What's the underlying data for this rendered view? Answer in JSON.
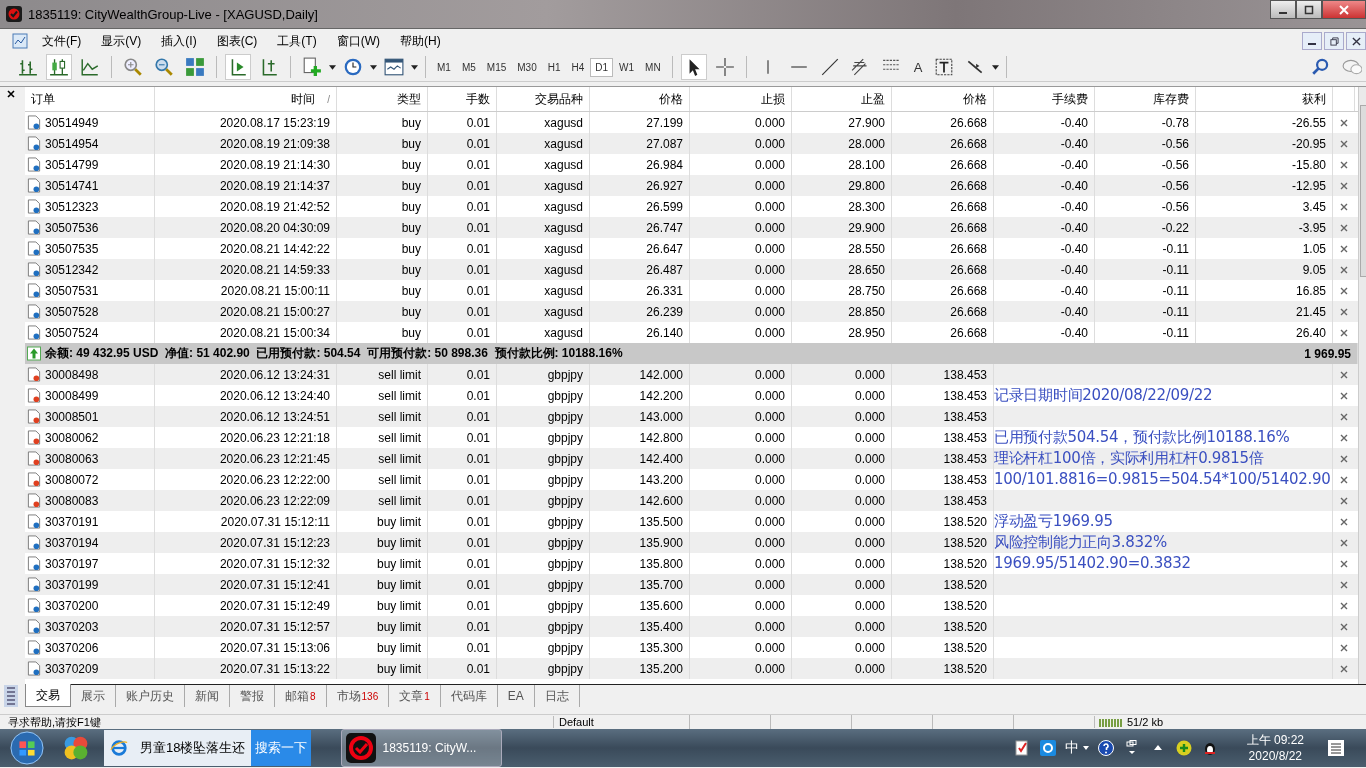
{
  "window": {
    "title": "1835119: CityWealthGroup-Live - [XAGUSD,Daily]"
  },
  "menu": [
    "文件(F)",
    "显示(V)",
    "插入(I)",
    "图表(C)",
    "工具(T)",
    "窗口(W)",
    "帮助(H)"
  ],
  "timeframes": [
    {
      "label": "M1",
      "selected": false
    },
    {
      "label": "M5",
      "selected": false
    },
    {
      "label": "M15",
      "selected": false
    },
    {
      "label": "M30",
      "selected": false
    },
    {
      "label": "H1",
      "selected": false
    },
    {
      "label": "H4",
      "selected": false
    },
    {
      "label": "D1",
      "selected": true
    },
    {
      "label": "W1",
      "selected": false
    },
    {
      "label": "MN",
      "selected": false
    }
  ],
  "text_tool": "A",
  "table": {
    "columns": [
      "订单",
      "时间",
      "类型",
      "手数",
      "交易品种",
      "价格",
      "止损",
      "止盈",
      "价格",
      "手续费",
      "库存费",
      "获利"
    ],
    "sort_mark": "/",
    "positions": [
      {
        "kind": "buy",
        "cells": [
          "30514949",
          "2020.08.17 15:23:19",
          "buy",
          "0.01",
          "xagusd",
          "27.199",
          "0.000",
          "27.900",
          "26.668",
          "-0.40",
          "-0.78",
          "-26.55"
        ]
      },
      {
        "kind": "buy",
        "cells": [
          "30514954",
          "2020.08.19 21:09:38",
          "buy",
          "0.01",
          "xagusd",
          "27.087",
          "0.000",
          "28.000",
          "26.668",
          "-0.40",
          "-0.56",
          "-20.95"
        ]
      },
      {
        "kind": "buy",
        "cells": [
          "30514799",
          "2020.08.19 21:14:30",
          "buy",
          "0.01",
          "xagusd",
          "26.984",
          "0.000",
          "28.100",
          "26.668",
          "-0.40",
          "-0.56",
          "-15.80"
        ]
      },
      {
        "kind": "buy",
        "cells": [
          "30514741",
          "2020.08.19 21:14:37",
          "buy",
          "0.01",
          "xagusd",
          "26.927",
          "0.000",
          "29.800",
          "26.668",
          "-0.40",
          "-0.56",
          "-12.95"
        ]
      },
      {
        "kind": "buy",
        "cells": [
          "30512323",
          "2020.08.19 21:42:52",
          "buy",
          "0.01",
          "xagusd",
          "26.599",
          "0.000",
          "28.300",
          "26.668",
          "-0.40",
          "-0.56",
          "3.45"
        ]
      },
      {
        "kind": "buy",
        "cells": [
          "30507536",
          "2020.08.20 04:30:09",
          "buy",
          "0.01",
          "xagusd",
          "26.747",
          "0.000",
          "29.900",
          "26.668",
          "-0.40",
          "-0.22",
          "-3.95"
        ]
      },
      {
        "kind": "buy",
        "cells": [
          "30507535",
          "2020.08.21 14:42:22",
          "buy",
          "0.01",
          "xagusd",
          "26.647",
          "0.000",
          "28.550",
          "26.668",
          "-0.40",
          "-0.11",
          "1.05"
        ]
      },
      {
        "kind": "buy",
        "cells": [
          "30512342",
          "2020.08.21 14:59:33",
          "buy",
          "0.01",
          "xagusd",
          "26.487",
          "0.000",
          "28.650",
          "26.668",
          "-0.40",
          "-0.11",
          "9.05"
        ]
      },
      {
        "kind": "buy",
        "cells": [
          "30507531",
          "2020.08.21 15:00:11",
          "buy",
          "0.01",
          "xagusd",
          "26.331",
          "0.000",
          "28.750",
          "26.668",
          "-0.40",
          "-0.11",
          "16.85"
        ]
      },
      {
        "kind": "buy",
        "cells": [
          "30507528",
          "2020.08.21 15:00:27",
          "buy",
          "0.01",
          "xagusd",
          "26.239",
          "0.000",
          "28.850",
          "26.668",
          "-0.40",
          "-0.11",
          "21.45"
        ]
      },
      {
        "kind": "buy",
        "cells": [
          "30507524",
          "2020.08.21 15:00:34",
          "buy",
          "0.01",
          "xagusd",
          "26.140",
          "0.000",
          "28.950",
          "26.668",
          "-0.40",
          "-0.11",
          "26.40"
        ]
      }
    ],
    "summary": {
      "text": "余额: 49 432.95 USD  净值: 51 402.90  已用预付款: 504.54  可用预付款: 50 898.36  预付款比例: 10188.16%",
      "profit": "1 969.95"
    },
    "orders": [
      {
        "kind": "sell",
        "cells": [
          "30008498",
          "2020.06.12 13:24:31",
          "sell limit",
          "0.01",
          "gbpjpy",
          "142.000",
          "0.000",
          "0.000",
          "138.453"
        ]
      },
      {
        "kind": "sell",
        "cells": [
          "30008499",
          "2020.06.12 13:24:40",
          "sell limit",
          "0.01",
          "gbpjpy",
          "142.200",
          "0.000",
          "0.000",
          "138.453"
        ],
        "note": "记录日期时间2020/08/22/09/22"
      },
      {
        "kind": "sell",
        "cells": [
          "30008501",
          "2020.06.12 13:24:51",
          "sell limit",
          "0.01",
          "gbpjpy",
          "143.000",
          "0.000",
          "0.000",
          "138.453"
        ]
      },
      {
        "kind": "sell",
        "cells": [
          "30080062",
          "2020.06.23 12:21:18",
          "sell limit",
          "0.01",
          "gbpjpy",
          "142.800",
          "0.000",
          "0.000",
          "138.453"
        ],
        "note": "已用预付款504.54，预付款比例10188.16%"
      },
      {
        "kind": "sell",
        "cells": [
          "30080063",
          "2020.06.23 12:21:45",
          "sell limit",
          "0.01",
          "gbpjpy",
          "142.400",
          "0.000",
          "0.000",
          "138.453"
        ],
        "note": "理论杆杠100倍，实际利用杠杆0.9815倍"
      },
      {
        "kind": "sell",
        "cells": [
          "30080072",
          "2020.06.23 12:22:00",
          "sell limit",
          "0.01",
          "gbpjpy",
          "143.200",
          "0.000",
          "0.000",
          "138.453"
        ],
        "note": "100/101.8816=0.9815=504.54*100/51402.90"
      },
      {
        "kind": "sell",
        "cells": [
          "30080083",
          "2020.06.23 12:22:09",
          "sell limit",
          "0.01",
          "gbpjpy",
          "142.600",
          "0.000",
          "0.000",
          "138.453"
        ]
      },
      {
        "kind": "buy",
        "cells": [
          "30370191",
          "2020.07.31 15:12:11",
          "buy limit",
          "0.01",
          "gbpjpy",
          "135.500",
          "0.000",
          "0.000",
          "138.520"
        ],
        "note": "浮动盈亏1969.95"
      },
      {
        "kind": "buy",
        "cells": [
          "30370194",
          "2020.07.31 15:12:23",
          "buy limit",
          "0.01",
          "gbpjpy",
          "135.900",
          "0.000",
          "0.000",
          "138.520"
        ],
        "note": "风险控制能力正向3.832%"
      },
      {
        "kind": "buy",
        "cells": [
          "30370197",
          "2020.07.31 15:12:32",
          "buy limit",
          "0.01",
          "gbpjpy",
          "135.800",
          "0.000",
          "0.000",
          "138.520"
        ],
        "note": "1969.95/51402.90=0.3832"
      },
      {
        "kind": "buy",
        "cells": [
          "30370199",
          "2020.07.31 15:12:41",
          "buy limit",
          "0.01",
          "gbpjpy",
          "135.700",
          "0.000",
          "0.000",
          "138.520"
        ]
      },
      {
        "kind": "buy",
        "cells": [
          "30370200",
          "2020.07.31 15:12:49",
          "buy limit",
          "0.01",
          "gbpjpy",
          "135.600",
          "0.000",
          "0.000",
          "138.520"
        ]
      },
      {
        "kind": "buy",
        "cells": [
          "30370203",
          "2020.07.31 15:12:57",
          "buy limit",
          "0.01",
          "gbpjpy",
          "135.400",
          "0.000",
          "0.000",
          "138.520"
        ]
      },
      {
        "kind": "buy",
        "cells": [
          "30370206",
          "2020.07.31 15:13:06",
          "buy limit",
          "0.01",
          "gbpjpy",
          "135.300",
          "0.000",
          "0.000",
          "138.520"
        ]
      },
      {
        "kind": "buy",
        "cells": [
          "30370209",
          "2020.07.31 15:13:22",
          "buy limit",
          "0.01",
          "gbpjpy",
          "135.200",
          "0.000",
          "0.000",
          "138.520"
        ]
      }
    ]
  },
  "tabs": [
    {
      "label": "交易",
      "selected": true
    },
    {
      "label": "展示",
      "selected": false
    },
    {
      "label": "账户历史",
      "selected": false
    },
    {
      "label": "新闻",
      "selected": false
    },
    {
      "label": "警报",
      "selected": false
    },
    {
      "label": "邮箱",
      "count": "8",
      "selected": false
    },
    {
      "label": "市场",
      "count": "136",
      "selected": false
    },
    {
      "label": "文章",
      "count": "1",
      "selected": false
    },
    {
      "label": "代码库",
      "selected": false
    },
    {
      "label": "EA",
      "selected": false
    },
    {
      "label": "日志",
      "selected": false
    }
  ],
  "status_bar": {
    "help": "寻求帮助,请按F1键",
    "profile": "Default",
    "traffic": "51/2 kb"
  },
  "taskbar": {
    "browser_item": "男童18楼坠落生还",
    "search_button": "搜索一下",
    "app_item": "1835119: CityW...",
    "ime": "中",
    "time": "上午 09:22",
    "date": "2020/8/22"
  }
}
